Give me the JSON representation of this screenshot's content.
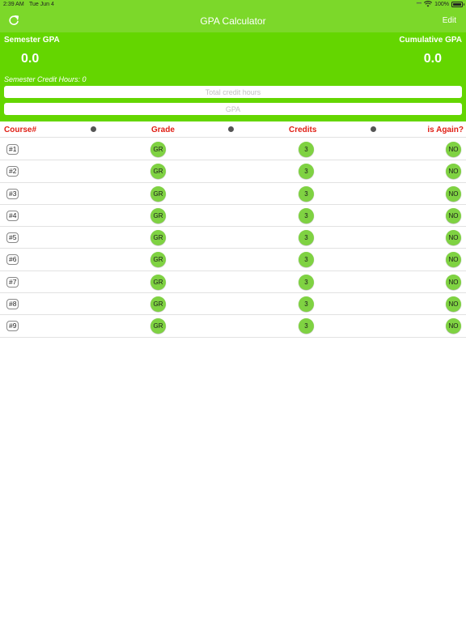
{
  "status_bar": {
    "time": "2:39 AM",
    "date": "Tue Jun 4",
    "battery": "100%"
  },
  "nav": {
    "title": "GPA Calculator",
    "edit_label": "Edit",
    "left_icon": "refresh-icon"
  },
  "summary": {
    "semester_label": "Semester GPA",
    "semester_value": "0.0",
    "cumulative_label": "Cumulative GPA",
    "cumulative_value": "0.0",
    "credit_hours_text": "Semester Credit Hours: 0",
    "total_hours_placeholder": "Total credit hours",
    "gpa_placeholder": "GPA"
  },
  "columns": {
    "course": "Course#",
    "grade": "Grade",
    "credits": "Credits",
    "again": "is Again?"
  },
  "courses": [
    {
      "number": "#1",
      "grade": "GR",
      "credits": "3",
      "again": "NO"
    },
    {
      "number": "#2",
      "grade": "GR",
      "credits": "3",
      "again": "NO"
    },
    {
      "number": "#3",
      "grade": "GR",
      "credits": "3",
      "again": "NO"
    },
    {
      "number": "#4",
      "grade": "GR",
      "credits": "3",
      "again": "NO"
    },
    {
      "number": "#5",
      "grade": "GR",
      "credits": "3",
      "again": "NO"
    },
    {
      "number": "#6",
      "grade": "GR",
      "credits": "3",
      "again": "NO"
    },
    {
      "number": "#7",
      "grade": "GR",
      "credits": "3",
      "again": "NO"
    },
    {
      "number": "#8",
      "grade": "GR",
      "credits": "3",
      "again": "NO"
    },
    {
      "number": "#9",
      "grade": "GR",
      "credits": "3",
      "again": "NO"
    }
  ],
  "colors": {
    "nav_green": "#7cd82a",
    "header_green": "#64d600",
    "column_red": "#e01e14",
    "circle_green": "#7fd242"
  }
}
